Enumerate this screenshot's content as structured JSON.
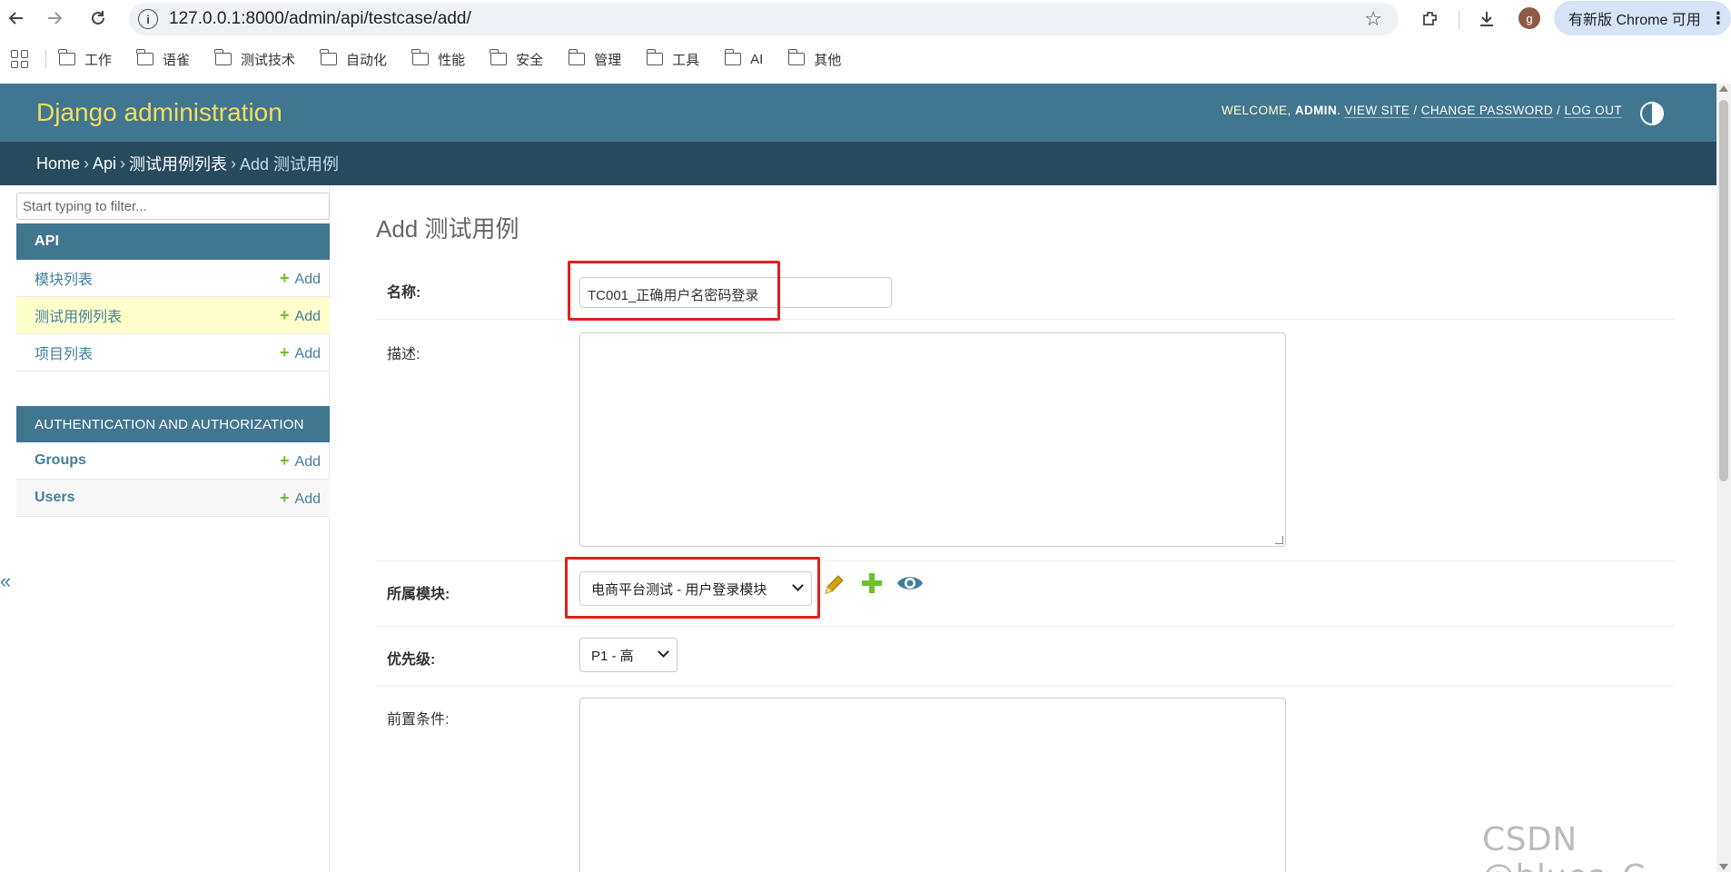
{
  "browser": {
    "url": "127.0.0.1:8000/admin/api/testcase/add/",
    "update_label": "有新版 Chrome 可用",
    "profile_initial": "g",
    "bookmarks": [
      "工作",
      "语雀",
      "测试技术",
      "自动化",
      "性能",
      "安全",
      "管理",
      "工具",
      "AI",
      "其他"
    ]
  },
  "header": {
    "branding": "Django administration",
    "welcome": "WELCOME,",
    "username": "ADMIN",
    "view_site": "VIEW SITE",
    "change_password": "CHANGE PASSWORD",
    "log_out": "LOG OUT"
  },
  "breadcrumbs": {
    "home": "Home",
    "app": "Api",
    "model": "测试用例列表",
    "current": "Add 测试用例"
  },
  "sidebar": {
    "filter_placeholder": "Start typing to filter...",
    "apps": [
      {
        "caption": "API",
        "models": [
          {
            "name": "模块列表",
            "add": "Add",
            "current": false
          },
          {
            "name": "测试用例列表",
            "add": "Add",
            "current": true
          },
          {
            "name": "项目列表",
            "add": "Add",
            "current": false
          }
        ]
      },
      {
        "caption": "AUTHENTICATION AND AUTHORIZATION",
        "models": [
          {
            "name": "Groups",
            "add": "Add",
            "current": false
          },
          {
            "name": "Users",
            "add": "Add",
            "current": false
          }
        ]
      }
    ],
    "collapse": "«"
  },
  "form": {
    "title": "Add 测试用例",
    "name_label": "名称:",
    "name_value": "TC001_正确用户名密码登录",
    "desc_label": "描述:",
    "module_label": "所属模块:",
    "module_value": "电商平台测试 - 用户登录模块",
    "priority_label": "优先级:",
    "priority_value": "P1 - 高",
    "precondition_label": "前置条件:"
  },
  "watermark": "CSDN @blues_C",
  "colors": {
    "header_bg": "#417690",
    "breadcrumb_bg": "#264b5d",
    "branding": "#f5dd5d",
    "link": "#447e9b",
    "add_plus": "#70bf2b",
    "highlight": "#e0201b",
    "current_row": "#ffffcc"
  }
}
